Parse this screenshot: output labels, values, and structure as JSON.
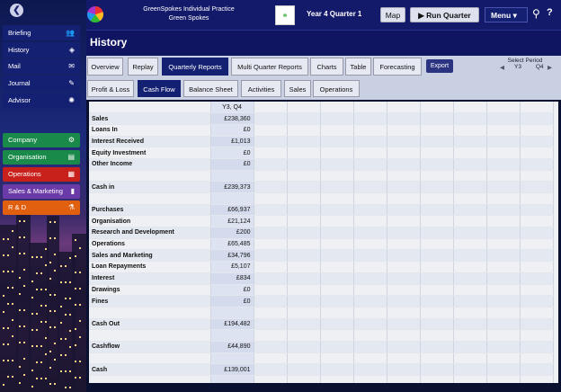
{
  "header": {
    "app_line1": "GreenSpokes Individual Practice",
    "app_line2": "Green Spokes",
    "quarter": "Year 4 Quarter 1",
    "map_label": "Map",
    "run_label": "Run Quarter",
    "menu_label": "Menu"
  },
  "page_title": "History",
  "sidebar": {
    "nav": [
      {
        "label": "Briefing",
        "icon": "👥"
      },
      {
        "label": "History",
        "icon": "◈"
      },
      {
        "label": "Mail",
        "icon": "✉"
      },
      {
        "label": "Journal",
        "icon": "✎"
      },
      {
        "label": "Advisor",
        "icon": "✺"
      }
    ],
    "sections": [
      {
        "label": "Company",
        "icon": "⚙",
        "color": "#1a8a4a"
      },
      {
        "label": "Organisation",
        "icon": "▤",
        "color": "#1a8a4a"
      },
      {
        "label": "Operations",
        "icon": "▦",
        "color": "#c8201a"
      },
      {
        "label": "Sales & Marketing",
        "icon": "▮",
        "color": "#6a3aa8"
      },
      {
        "label": "R & D",
        "icon": "⚗",
        "color": "#e06010"
      }
    ]
  },
  "tabs": [
    "Overview",
    "Replay",
    "Quarterly Reports",
    "Multi Quarter Reports",
    "Charts",
    "Table",
    "Forecasting"
  ],
  "export_label": "Export",
  "select_period": {
    "label": "Select Period",
    "year": "Y3",
    "quarter": "Q4"
  },
  "subtabs": [
    "Profit & Loss",
    "Cash Flow",
    "Balance Sheet",
    "Activities",
    "Sales",
    "Operations"
  ],
  "grid": {
    "column_header": "Y3, Q4",
    "rows": [
      {
        "label": "Sales",
        "value": "£238,360"
      },
      {
        "label": "Loans In",
        "value": "£0"
      },
      {
        "label": "Interest Received",
        "value": "£1,013"
      },
      {
        "label": "Equity Investment",
        "value": "£0"
      },
      {
        "label": "Other Income",
        "value": "£0"
      },
      {
        "label": "",
        "value": ""
      },
      {
        "label": "Cash in",
        "value": "£239,373"
      },
      {
        "label": "",
        "value": ""
      },
      {
        "label": "Purchases",
        "value": "£66,937"
      },
      {
        "label": "Organisation",
        "value": "£21,124"
      },
      {
        "label": "Research and Development",
        "value": "£200"
      },
      {
        "label": "Operations",
        "value": "£65,485"
      },
      {
        "label": "Sales and Marketing",
        "value": "£34,796"
      },
      {
        "label": "Loan Repayments",
        "value": "£5,107"
      },
      {
        "label": "Interest",
        "value": "£834"
      },
      {
        "label": "Drawings",
        "value": "£0"
      },
      {
        "label": "Fines",
        "value": "£0"
      },
      {
        "label": "",
        "value": ""
      },
      {
        "label": "Cash Out",
        "value": "£194,482"
      },
      {
        "label": "",
        "value": ""
      },
      {
        "label": "Cashflow",
        "value": "£44,890"
      },
      {
        "label": "",
        "value": ""
      },
      {
        "label": "Cash",
        "value": "£139,001"
      },
      {
        "label": "",
        "value": ""
      }
    ]
  }
}
